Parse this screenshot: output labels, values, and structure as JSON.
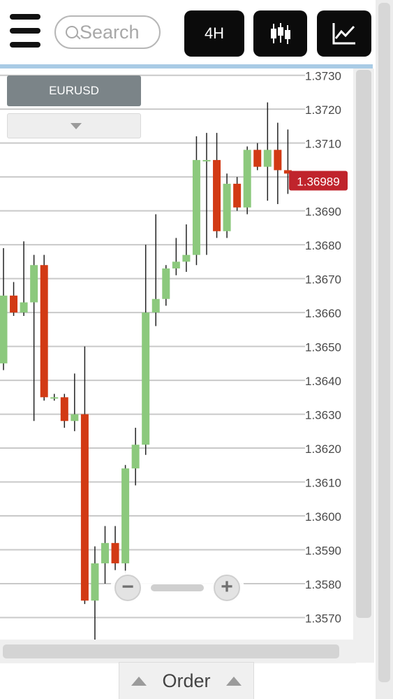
{
  "toolbar": {
    "search_placeholder": "Search",
    "timeframe_label": "4H",
    "menu_icon": "hamburger-menu-icon",
    "chart_type_icon": "candlestick-icon",
    "indicators_icon": "line-chart-icon"
  },
  "symbol": {
    "name": "EURUSD"
  },
  "price": {
    "current": "1.36989",
    "current_value": 1.36989,
    "badge_color": "#c0242c"
  },
  "zoom": {
    "minus_label": "−",
    "plus_label": "+"
  },
  "order": {
    "label": "Order"
  },
  "colors": {
    "up": "#8cc97d",
    "down": "#d23a14",
    "accent": "#a9cbe5"
  },
  "chart_data": {
    "type": "candlestick",
    "yticks": [
      "1.3730",
      "1.3720",
      "1.3710",
      "1.3700",
      "1.3690",
      "1.3680",
      "1.3670",
      "1.3660",
      "1.3650",
      "1.3640",
      "1.3630",
      "1.3620",
      "1.3610",
      "1.3600",
      "1.3590",
      "1.3580",
      "1.3570"
    ],
    "ylim": [
      1.35635,
      1.3732
    ],
    "grid": true,
    "candles": [
      {
        "o": 1.3645,
        "h": 1.3679,
        "l": 1.3643,
        "c": 1.3665
      },
      {
        "o": 1.3665,
        "h": 1.3669,
        "l": 1.3659,
        "c": 1.366
      },
      {
        "o": 1.366,
        "h": 1.3681,
        "l": 1.3659,
        "c": 1.3663
      },
      {
        "o": 1.3663,
        "h": 1.3677,
        "l": 1.3628,
        "c": 1.3674
      },
      {
        "o": 1.3674,
        "h": 1.3677,
        "l": 1.3634,
        "c": 1.3635
      },
      {
        "o": 1.3635,
        "h": 1.3636,
        "l": 1.3634,
        "c": 1.3635
      },
      {
        "o": 1.3635,
        "h": 1.3636,
        "l": 1.3626,
        "c": 1.3628
      },
      {
        "o": 1.3628,
        "h": 1.3642,
        "l": 1.3625,
        "c": 1.363
      },
      {
        "o": 1.363,
        "h": 1.365,
        "l": 1.3574,
        "c": 1.3575
      },
      {
        "o": 1.3575,
        "h": 1.3591,
        "l": 1.3563,
        "c": 1.3586
      },
      {
        "o": 1.3586,
        "h": 1.3597,
        "l": 1.358,
        "c": 1.3592
      },
      {
        "o": 1.3592,
        "h": 1.3597,
        "l": 1.3584,
        "c": 1.3586
      },
      {
        "o": 1.3586,
        "h": 1.3615,
        "l": 1.3583,
        "c": 1.3614
      },
      {
        "o": 1.3614,
        "h": 1.3626,
        "l": 1.3609,
        "c": 1.3621
      },
      {
        "o": 1.3621,
        "h": 1.368,
        "l": 1.3618,
        "c": 1.366
      },
      {
        "o": 1.366,
        "h": 1.3689,
        "l": 1.3656,
        "c": 1.3664
      },
      {
        "o": 1.3664,
        "h": 1.3674,
        "l": 1.3662,
        "c": 1.3673
      },
      {
        "o": 1.3673,
        "h": 1.3682,
        "l": 1.3671,
        "c": 1.3675
      },
      {
        "o": 1.3675,
        "h": 1.3686,
        "l": 1.3672,
        "c": 1.3677
      },
      {
        "o": 1.3677,
        "h": 1.3712,
        "l": 1.3674,
        "c": 1.3705
      },
      {
        "o": 1.3705,
        "h": 1.3713,
        "l": 1.3677,
        "c": 1.3705
      },
      {
        "o": 1.3705,
        "h": 1.3713,
        "l": 1.3682,
        "c": 1.3684
      },
      {
        "o": 1.3684,
        "h": 1.3701,
        "l": 1.3682,
        "c": 1.3698
      },
      {
        "o": 1.3698,
        "h": 1.37,
        "l": 1.369,
        "c": 1.3691
      },
      {
        "o": 1.3691,
        "h": 1.3709,
        "l": 1.3689,
        "c": 1.3708
      },
      {
        "o": 1.3708,
        "h": 1.371,
        "l": 1.3702,
        "c": 1.3703
      },
      {
        "o": 1.3703,
        "h": 1.3722,
        "l": 1.3693,
        "c": 1.3708
      },
      {
        "o": 1.3708,
        "h": 1.3716,
        "l": 1.3692,
        "c": 1.3702
      },
      {
        "o": 1.3702,
        "h": 1.3714,
        "l": 1.3695,
        "c": 1.3701
      }
    ]
  }
}
